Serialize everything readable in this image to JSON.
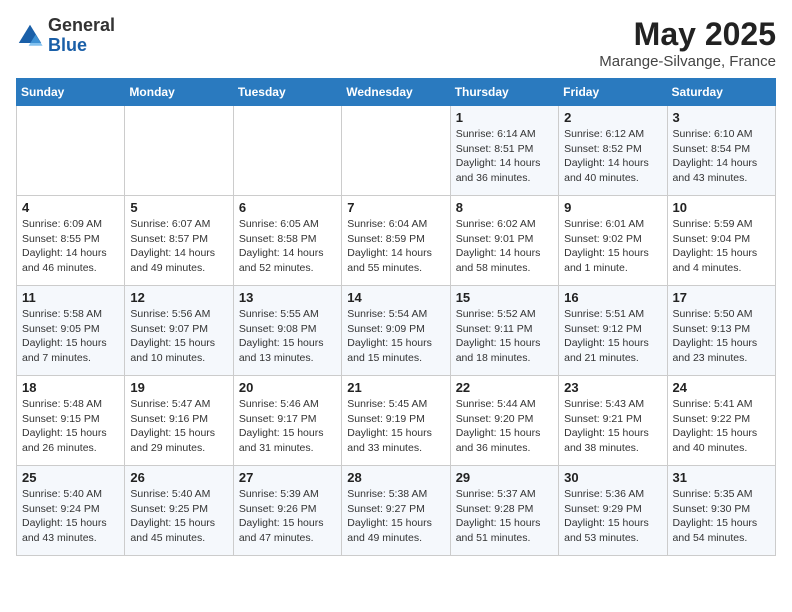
{
  "header": {
    "logo_general": "General",
    "logo_blue": "Blue",
    "month_year": "May 2025",
    "location": "Marange-Silvange, France"
  },
  "weekdays": [
    "Sunday",
    "Monday",
    "Tuesday",
    "Wednesday",
    "Thursday",
    "Friday",
    "Saturday"
  ],
  "weeks": [
    [
      {
        "day": "",
        "info": ""
      },
      {
        "day": "",
        "info": ""
      },
      {
        "day": "",
        "info": ""
      },
      {
        "day": "",
        "info": ""
      },
      {
        "day": "1",
        "info": "Sunrise: 6:14 AM\nSunset: 8:51 PM\nDaylight: 14 hours and 36 minutes."
      },
      {
        "day": "2",
        "info": "Sunrise: 6:12 AM\nSunset: 8:52 PM\nDaylight: 14 hours and 40 minutes."
      },
      {
        "day": "3",
        "info": "Sunrise: 6:10 AM\nSunset: 8:54 PM\nDaylight: 14 hours and 43 minutes."
      }
    ],
    [
      {
        "day": "4",
        "info": "Sunrise: 6:09 AM\nSunset: 8:55 PM\nDaylight: 14 hours and 46 minutes."
      },
      {
        "day": "5",
        "info": "Sunrise: 6:07 AM\nSunset: 8:57 PM\nDaylight: 14 hours and 49 minutes."
      },
      {
        "day": "6",
        "info": "Sunrise: 6:05 AM\nSunset: 8:58 PM\nDaylight: 14 hours and 52 minutes."
      },
      {
        "day": "7",
        "info": "Sunrise: 6:04 AM\nSunset: 8:59 PM\nDaylight: 14 hours and 55 minutes."
      },
      {
        "day": "8",
        "info": "Sunrise: 6:02 AM\nSunset: 9:01 PM\nDaylight: 14 hours and 58 minutes."
      },
      {
        "day": "9",
        "info": "Sunrise: 6:01 AM\nSunset: 9:02 PM\nDaylight: 15 hours and 1 minute."
      },
      {
        "day": "10",
        "info": "Sunrise: 5:59 AM\nSunset: 9:04 PM\nDaylight: 15 hours and 4 minutes."
      }
    ],
    [
      {
        "day": "11",
        "info": "Sunrise: 5:58 AM\nSunset: 9:05 PM\nDaylight: 15 hours and 7 minutes."
      },
      {
        "day": "12",
        "info": "Sunrise: 5:56 AM\nSunset: 9:07 PM\nDaylight: 15 hours and 10 minutes."
      },
      {
        "day": "13",
        "info": "Sunrise: 5:55 AM\nSunset: 9:08 PM\nDaylight: 15 hours and 13 minutes."
      },
      {
        "day": "14",
        "info": "Sunrise: 5:54 AM\nSunset: 9:09 PM\nDaylight: 15 hours and 15 minutes."
      },
      {
        "day": "15",
        "info": "Sunrise: 5:52 AM\nSunset: 9:11 PM\nDaylight: 15 hours and 18 minutes."
      },
      {
        "day": "16",
        "info": "Sunrise: 5:51 AM\nSunset: 9:12 PM\nDaylight: 15 hours and 21 minutes."
      },
      {
        "day": "17",
        "info": "Sunrise: 5:50 AM\nSunset: 9:13 PM\nDaylight: 15 hours and 23 minutes."
      }
    ],
    [
      {
        "day": "18",
        "info": "Sunrise: 5:48 AM\nSunset: 9:15 PM\nDaylight: 15 hours and 26 minutes."
      },
      {
        "day": "19",
        "info": "Sunrise: 5:47 AM\nSunset: 9:16 PM\nDaylight: 15 hours and 29 minutes."
      },
      {
        "day": "20",
        "info": "Sunrise: 5:46 AM\nSunset: 9:17 PM\nDaylight: 15 hours and 31 minutes."
      },
      {
        "day": "21",
        "info": "Sunrise: 5:45 AM\nSunset: 9:19 PM\nDaylight: 15 hours and 33 minutes."
      },
      {
        "day": "22",
        "info": "Sunrise: 5:44 AM\nSunset: 9:20 PM\nDaylight: 15 hours and 36 minutes."
      },
      {
        "day": "23",
        "info": "Sunrise: 5:43 AM\nSunset: 9:21 PM\nDaylight: 15 hours and 38 minutes."
      },
      {
        "day": "24",
        "info": "Sunrise: 5:41 AM\nSunset: 9:22 PM\nDaylight: 15 hours and 40 minutes."
      }
    ],
    [
      {
        "day": "25",
        "info": "Sunrise: 5:40 AM\nSunset: 9:24 PM\nDaylight: 15 hours and 43 minutes."
      },
      {
        "day": "26",
        "info": "Sunrise: 5:40 AM\nSunset: 9:25 PM\nDaylight: 15 hours and 45 minutes."
      },
      {
        "day": "27",
        "info": "Sunrise: 5:39 AM\nSunset: 9:26 PM\nDaylight: 15 hours and 47 minutes."
      },
      {
        "day": "28",
        "info": "Sunrise: 5:38 AM\nSunset: 9:27 PM\nDaylight: 15 hours and 49 minutes."
      },
      {
        "day": "29",
        "info": "Sunrise: 5:37 AM\nSunset: 9:28 PM\nDaylight: 15 hours and 51 minutes."
      },
      {
        "day": "30",
        "info": "Sunrise: 5:36 AM\nSunset: 9:29 PM\nDaylight: 15 hours and 53 minutes."
      },
      {
        "day": "31",
        "info": "Sunrise: 5:35 AM\nSunset: 9:30 PM\nDaylight: 15 hours and 54 minutes."
      }
    ]
  ]
}
